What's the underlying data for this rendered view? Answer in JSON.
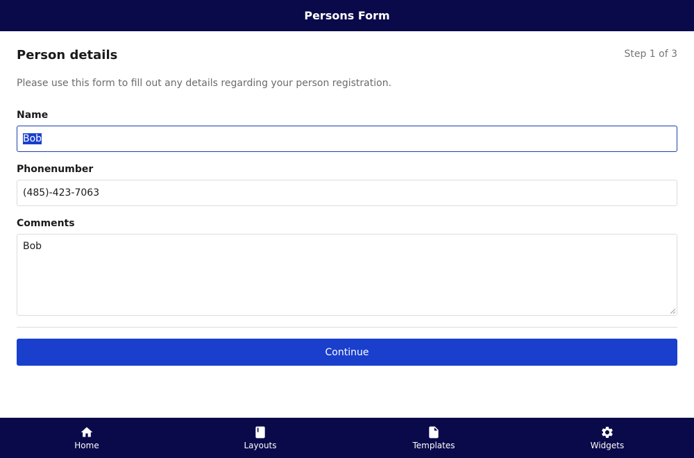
{
  "app": {
    "title": "Persons Form"
  },
  "form": {
    "title": "Person details",
    "step": "Step 1 of 3",
    "description": "Please use this form to fill out any details regarding your person registration.",
    "fields": {
      "name": {
        "label": "Name",
        "value": "Bob"
      },
      "phone": {
        "label": "Phonenumber",
        "value": "(485)-423-7063"
      },
      "comments": {
        "label": "Comments",
        "value": "Bob"
      }
    },
    "continue_label": "Continue"
  },
  "bottom_nav": {
    "items": [
      {
        "label": "Home",
        "icon": "home-icon"
      },
      {
        "label": "Layouts",
        "icon": "book-icon"
      },
      {
        "label": "Templates",
        "icon": "file-icon"
      },
      {
        "label": "Widgets",
        "icon": "gear-icon"
      }
    ]
  },
  "colors": {
    "header_bg": "#0a0a4a",
    "accent": "#1a3fcc",
    "nav_bg": "#0a0a4a"
  }
}
